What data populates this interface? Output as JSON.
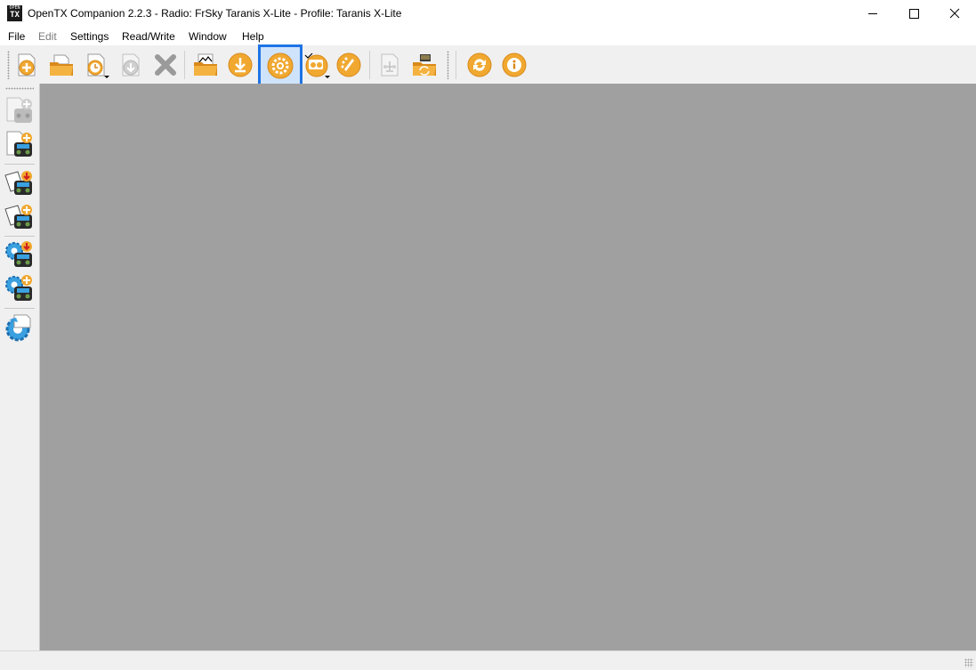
{
  "window": {
    "icon_top": "OPEN",
    "icon_bottom": "TX",
    "title": "OpenTX Companion 2.2.3 - Radio: FrSky Taranis X-Lite - Profile: Taranis X-Lite"
  },
  "menu": {
    "file": "File",
    "edit": "Edit",
    "settings": "Settings",
    "readwrite": "Read/Write",
    "window": "Window",
    "help": "Help"
  },
  "toolbar": {
    "buttons": [
      {
        "icon": "new-document-icon",
        "enabled": true
      },
      {
        "icon": "open-folder-icon",
        "enabled": true
      },
      {
        "icon": "recent-files-icon",
        "enabled": true,
        "dropdown": true
      },
      {
        "icon": "save-icon",
        "enabled": false
      },
      {
        "icon": "close-icon",
        "enabled": true
      },
      {
        "icon": "logs-icon",
        "enabled": true
      },
      {
        "icon": "download-icon",
        "enabled": true
      },
      {
        "icon": "settings-gear-icon",
        "enabled": true,
        "active": true
      },
      {
        "icon": "profile-icon",
        "enabled": true,
        "dropdown": true
      },
      {
        "icon": "customize-splash-icon",
        "enabled": true
      },
      {
        "icon": "compare-icon",
        "enabled": false
      },
      {
        "icon": "sd-sync-icon",
        "enabled": true
      },
      {
        "icon": "check-updates-icon",
        "enabled": true
      },
      {
        "icon": "about-icon",
        "enabled": true
      }
    ]
  },
  "leftbar": {
    "buttons": [
      {
        "icon": "write-models-to-radio-icon",
        "enabled": false
      },
      {
        "icon": "read-models-from-radio-icon",
        "enabled": true
      },
      {
        "icon": "write-backup-to-radio-icon",
        "enabled": true
      },
      {
        "icon": "backup-radio-icon",
        "enabled": true
      },
      {
        "icon": "write-firmware-icon",
        "enabled": true
      },
      {
        "icon": "read-firmware-icon",
        "enabled": true
      },
      {
        "icon": "bootloader-icon",
        "enabled": true
      }
    ]
  },
  "colors": {
    "accent": "#1e73e6",
    "icon_orange": "#f0a830",
    "icon_orange_dark": "#d9891a",
    "mdi_background": "#a0a0a0",
    "chrome": "#f0f0f0",
    "disabled_icon": "#c8c8c8"
  }
}
